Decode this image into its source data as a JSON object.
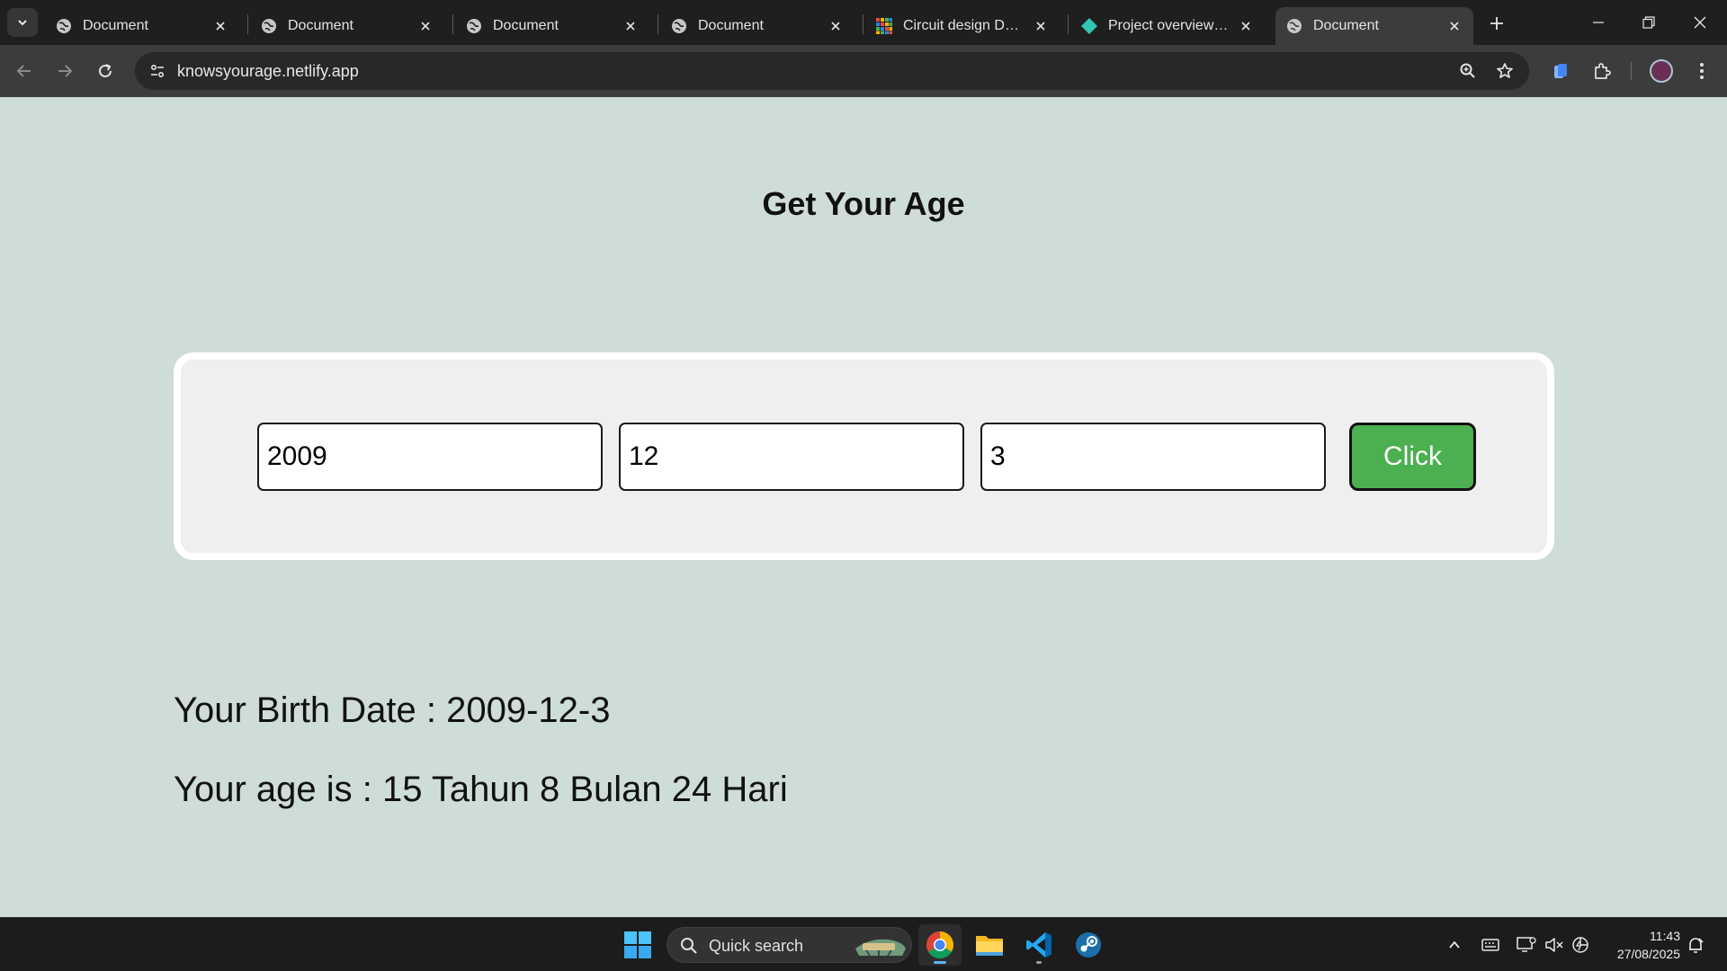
{
  "browser": {
    "tabs": [
      {
        "title": "Document",
        "favicon": "globe-icon",
        "active": false
      },
      {
        "title": "Document",
        "favicon": "globe-icon",
        "active": false
      },
      {
        "title": "Document",
        "favicon": "globe-icon",
        "active": false
      },
      {
        "title": "Document",
        "favicon": "globe-icon",
        "active": false
      },
      {
        "title": "Circuit design Dazzling",
        "favicon": "tinkercad-icon",
        "active": false
      },
      {
        "title": "Project overview | knowsyourage",
        "favicon": "netlify-icon",
        "active": false
      },
      {
        "title": "Document",
        "favicon": "globe-icon",
        "active": true
      }
    ],
    "url": "knowsyourage.netlify.app"
  },
  "page": {
    "heading": "Get Your Age",
    "inputs": {
      "year": "2009",
      "month": "12",
      "day": "3"
    },
    "button_label": "Click",
    "birth_date_line": "Your Birth Date : 2009-12-3",
    "age_line": "Your age is : 15 Tahun 8 Bulan 24 Hari"
  },
  "taskbar": {
    "search_label": "Quick search",
    "apps": [
      "windows-start-icon",
      "chrome-icon",
      "file-explorer-icon",
      "vscode-icon",
      "steam-icon"
    ]
  },
  "clock": {
    "time": "11:43",
    "date": "27/08/2025"
  },
  "colors": {
    "page_background": "#cfddd7",
    "button_green": "#4caf50",
    "card_background": "#efefef"
  }
}
